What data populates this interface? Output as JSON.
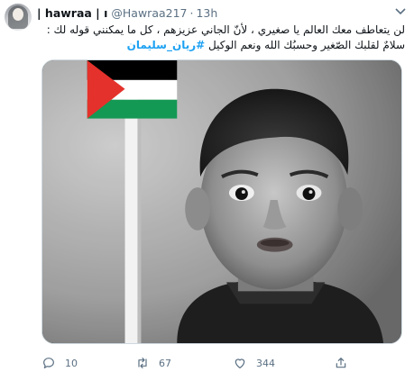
{
  "tweet": {
    "author_name": "| hawraa | ı",
    "author_handle": "@Hawraa217",
    "separator": "·",
    "time": "13h",
    "text_line1": "لن يتعاطف معك العالم يا صغيري ، لأنّ الجاني  عزيزهم ، كل ما يمكنني قوله لك :",
    "text_line2": "سلامٌ لقلبك الصّغير وحسبُك الله ونعم الوكيل",
    "hashtag": "#ريان_سليمان"
  },
  "media": {
    "flag_colors": {
      "black": "#000000",
      "white": "#ffffff",
      "green": "#149954",
      "red": "#e4312b"
    }
  },
  "actions": {
    "replies": "10",
    "retweets": "67",
    "likes": "344"
  },
  "colors": {
    "link": "#1da1f2",
    "secondary": "#5b7083",
    "text": "#0f1419"
  },
  "icons": [
    "reply-icon",
    "retweet-icon",
    "like-icon",
    "share-icon",
    "caret-down-icon"
  ]
}
